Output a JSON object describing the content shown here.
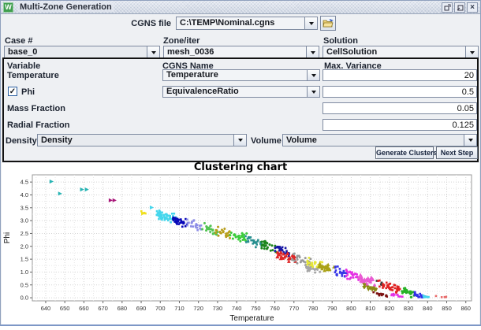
{
  "window": {
    "title": "Multi-Zone Generation",
    "icon_letter": "W",
    "close_glyph": "×"
  },
  "cgns": {
    "label": "CGNS file",
    "value": "C:\\TEMP\\Nominal.cgns"
  },
  "selectors": {
    "case": {
      "label": "Case #",
      "value": "base_0"
    },
    "zone": {
      "label": "Zone/iter",
      "value": "mesh_0036"
    },
    "solution": {
      "label": "Solution",
      "value": "CellSolution"
    }
  },
  "panel": {
    "headers": {
      "variable": "Variable",
      "cgns_name": "CGNS Name",
      "max_variance": "Max. Variance"
    },
    "rows": [
      {
        "label": "Temperature",
        "cgns": "Temperature",
        "variance": "20"
      },
      {
        "label": "Phi",
        "checked": true,
        "check_glyph": "✓",
        "cgns": "EquivalenceRatio",
        "variance": "0.5"
      },
      {
        "label": "Mass Fraction",
        "variance": "0.05"
      },
      {
        "label": "Radial Fraction",
        "variance": "0.125"
      }
    ],
    "density": {
      "label": "Density",
      "value": "Density"
    },
    "volume": {
      "label": "Volume",
      "value": "Volume"
    },
    "buttons": {
      "generate": "Generate Clusters",
      "next": "Next Step"
    }
  },
  "chart_data": {
    "type": "scatter",
    "title": "Clustering chart",
    "xlabel": "Temperature",
    "ylabel": "Phi",
    "xlim": [
      633,
      863
    ],
    "ylim": [
      -0.12,
      4.78
    ],
    "xticks": [
      640,
      650,
      660,
      670,
      680,
      690,
      700,
      710,
      720,
      730,
      740,
      750,
      760,
      770,
      780,
      790,
      800,
      810,
      820,
      830,
      840,
      850,
      860
    ],
    "yticks": [
      0.0,
      0.5,
      1.0,
      1.5,
      2.0,
      2.5,
      3.0,
      3.5,
      4.0,
      4.5
    ],
    "grid": {
      "x_minor_step": 5,
      "y_minor_step": 0.25
    },
    "band_slope": -0.0229,
    "clusters": [
      {
        "x": 692,
        "y": 3.3,
        "c": "#f0e020",
        "n": 4,
        "sx": 3,
        "sy": 0.1,
        "m": "sq"
      },
      {
        "x": 703,
        "y": 3.17,
        "c": "#45d6ec",
        "n": 60,
        "sx": 5.5,
        "sy": 0.13,
        "m": "sq"
      },
      {
        "x": 710.5,
        "y": 2.97,
        "c": "#0808b8",
        "n": 32,
        "sx": 4,
        "sy": 0.1,
        "m": "sq"
      },
      {
        "x": 718,
        "y": 2.82,
        "c": "#8d8de6",
        "n": 24,
        "sx": 4,
        "sy": 0.1,
        "m": "sq"
      },
      {
        "x": 726,
        "y": 2.66,
        "c": "#52c352",
        "n": 26,
        "sx": 4,
        "sy": 0.11,
        "m": "ci"
      },
      {
        "x": 733,
        "y": 2.52,
        "c": "#b89e1c",
        "n": 22,
        "sx": 4,
        "sy": 0.12,
        "m": "ci"
      },
      {
        "x": 741,
        "y": 2.37,
        "c": "#3ccc3c",
        "n": 26,
        "sx": 4.5,
        "sy": 0.12,
        "m": "ci"
      },
      {
        "x": 749,
        "y": 2.19,
        "c": "#278f8f",
        "n": 30,
        "sx": 4.5,
        "sy": 0.11,
        "m": "sq"
      },
      {
        "x": 757,
        "y": 2.01,
        "c": "#1d851d",
        "n": 26,
        "sx": 4,
        "sy": 0.11,
        "m": "ci"
      },
      {
        "x": 764,
        "y": 1.85,
        "c": "#1717a6",
        "n": 26,
        "sx": 4,
        "sy": 0.1,
        "m": "sq"
      },
      {
        "x": 766,
        "y": 1.58,
        "c": "#de2626",
        "n": 26,
        "sx": 5,
        "sy": 0.12,
        "m": "tu"
      },
      {
        "x": 774,
        "y": 1.47,
        "c": "#989898",
        "n": 28,
        "sx": 5,
        "sy": 0.12,
        "m": "ci"
      },
      {
        "x": 781,
        "y": 1.34,
        "c": "#e6e636",
        "n": 26,
        "sx": 4.5,
        "sy": 0.12,
        "m": "sq"
      },
      {
        "x": 787,
        "y": 1.21,
        "c": "#aaa216",
        "n": 22,
        "sx": 4,
        "sy": 0.11,
        "m": "tu"
      },
      {
        "x": 780,
        "y": 1.1,
        "c": "#a6a6a6",
        "n": 16,
        "sx": 4,
        "sy": 0.09,
        "m": "ci"
      },
      {
        "x": 794,
        "y": 1.03,
        "c": "#3636e6",
        "n": 26,
        "sx": 4,
        "sy": 0.12,
        "m": "sq"
      },
      {
        "x": 801,
        "y": 0.87,
        "c": "#e431e4",
        "n": 24,
        "sx": 4.5,
        "sy": 0.12,
        "m": "ci"
      },
      {
        "x": 808,
        "y": 0.71,
        "c": "#ea5ad2",
        "n": 26,
        "sx": 4.5,
        "sy": 0.12,
        "m": "tu"
      },
      {
        "x": 815,
        "y": 0.6,
        "c": "#3c3c3c",
        "n": 6,
        "sx": 2,
        "sy": 0.05,
        "m": "sq"
      },
      {
        "x": 820,
        "y": 0.47,
        "c": "#df2222",
        "n": 42,
        "sx": 6,
        "sy": 0.14,
        "m": "sq"
      },
      {
        "x": 810,
        "y": 0.36,
        "c": "#8a8a12",
        "n": 14,
        "sx": 4,
        "sy": 0.07,
        "m": "td"
      },
      {
        "x": 815,
        "y": 0.12,
        "c": "#7c1010",
        "n": 14,
        "sx": 4,
        "sy": 0.06,
        "m": "sq"
      },
      {
        "x": 824,
        "y": 0.08,
        "c": "#e431e4",
        "n": 10,
        "sx": 3,
        "sy": 0.04,
        "m": "sq"
      },
      {
        "x": 830,
        "y": 0.19,
        "c": "#27b227",
        "n": 26,
        "sx": 3.5,
        "sy": 0.1,
        "m": "ci"
      },
      {
        "x": 836,
        "y": 0.08,
        "c": "#3030e6",
        "n": 26,
        "sx": 3,
        "sy": 0.05,
        "m": "sq"
      },
      {
        "x": 839,
        "y": 0.04,
        "c": "#45d6ec",
        "n": 8,
        "sx": 2,
        "sy": 0.03,
        "m": "sq"
      },
      {
        "x": 847,
        "y": 0.03,
        "c": "#e86a6a",
        "n": 5,
        "sx": 3.5,
        "sy": 0.02,
        "m": "sq"
      }
    ],
    "outliers": [
      {
        "x": 643,
        "y": 4.52,
        "c": "#28b4b4"
      },
      {
        "x": 647.5,
        "y": 4.05,
        "c": "#28b4b4"
      },
      {
        "x": 659,
        "y": 4.21,
        "c": "#28b4b4"
      },
      {
        "x": 661.5,
        "y": 4.21,
        "c": "#28b4b4"
      },
      {
        "x": 674,
        "y": 3.79,
        "c": "#a81478"
      },
      {
        "x": 676,
        "y": 3.79,
        "c": "#a81478"
      },
      {
        "x": 691,
        "y": 3.28,
        "c": "#f0e020"
      },
      {
        "x": 695.5,
        "y": 3.51,
        "c": "#45d6ec"
      }
    ]
  }
}
